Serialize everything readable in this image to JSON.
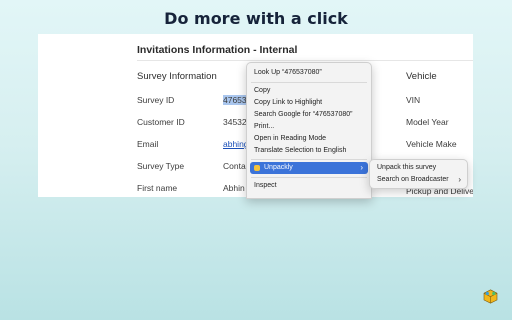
{
  "headline": "Do more with a click",
  "panel": {
    "title": "Invitations Information - Internal",
    "left_header": "Survey Information",
    "right_header": "Vehicle",
    "rows": [
      {
        "label": "Survey ID",
        "value": "47653",
        "right": "VIN"
      },
      {
        "label": "Customer ID",
        "value": "34532",
        "right": "Model Year"
      },
      {
        "label": "Email",
        "value": "abhing",
        "right": "Vehicle Make"
      },
      {
        "label": "Survey Type",
        "value": "Contac",
        "right": ""
      },
      {
        "label": "First name",
        "value": "Abhin",
        "right": "Pickup and Delivery"
      }
    ]
  },
  "context_menu": {
    "items": [
      "Look Up “476537080”",
      "Copy",
      "Copy Link to Highlight",
      "Search Google for “476537080”",
      "Print...",
      "Open in Reading Mode",
      "Translate Selection to English",
      "Unpackly",
      "Inspect"
    ],
    "highlighted": "Unpackly"
  },
  "submenu": {
    "items": [
      "Unpack this survey",
      "Search on Broadcaster"
    ]
  },
  "colors": {
    "accent": "#3b73d9",
    "selection": "#a9c6ee",
    "link": "#1a4fb8"
  },
  "icons": {
    "extension": "unpackly-logo-icon",
    "submenu_arrow": "chevron-right-icon"
  }
}
